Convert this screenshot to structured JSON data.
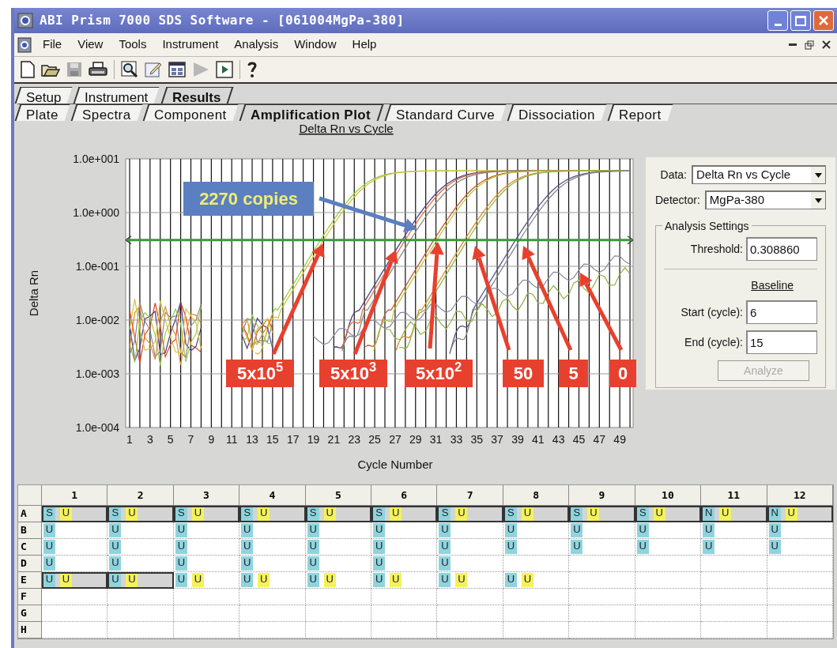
{
  "window": {
    "title": "ABI Prism 7000 SDS Software - [061004MgPa-380]"
  },
  "menu": [
    "File",
    "View",
    "Tools",
    "Instrument",
    "Analysis",
    "Window",
    "Help"
  ],
  "tabs": [
    {
      "label": "Setup",
      "selected": false
    },
    {
      "label": "Instrument",
      "selected": false
    },
    {
      "label": "Results",
      "selected": true
    }
  ],
  "subtabs": [
    {
      "label": "Plate",
      "selected": false
    },
    {
      "label": "Spectra",
      "selected": false
    },
    {
      "label": "Component",
      "selected": false
    },
    {
      "label": "Amplification Plot",
      "selected": true
    },
    {
      "label": "Standard Curve",
      "selected": false
    },
    {
      "label": "Dissociation",
      "selected": false
    },
    {
      "label": "Report",
      "selected": false
    }
  ],
  "plot": {
    "title": "Delta Rn vs Cycle",
    "ylabel": "Delta Rn",
    "xlabel": "Cycle Number",
    "yticks": [
      "1.0e+001",
      "1.0e+000",
      "1.0e-001",
      "1.0e-002",
      "1.0e-003",
      "1.0e-004"
    ],
    "xticks": [
      "1",
      "3",
      "5",
      "7",
      "9",
      "11",
      "13",
      "15",
      "17",
      "19",
      "21",
      "23",
      "25",
      "27",
      "29",
      "31",
      "33",
      "35",
      "37",
      "39",
      "41",
      "43",
      "45",
      "47",
      "49"
    ],
    "callouts": [
      {
        "text": "2270 copies",
        "color": "#5b7fc0"
      },
      {
        "text": "5x10$^{5}$",
        "color": "#e8402e"
      },
      {
        "text": "5x10$^{3}$",
        "color": "#e8402e"
      },
      {
        "text": "5x10$^{2}$",
        "color": "#e8402e"
      },
      {
        "text": "50",
        "color": "#e8402e"
      },
      {
        "text": "5",
        "color": "#e8402e"
      },
      {
        "text": "0",
        "color": "#e8402e"
      }
    ]
  },
  "panel": {
    "data": {
      "label": "Data:",
      "value": "Delta Rn vs Cycle"
    },
    "detector": {
      "label": "Detector:",
      "value": "MgPa-380"
    },
    "group": "Analysis Settings",
    "threshold": {
      "label": "Threshold:",
      "value": "0.308860"
    },
    "baseline": "Baseline",
    "start": {
      "label": "Start (cycle):",
      "value": "6"
    },
    "end": {
      "label": "End (cycle):",
      "value": "15"
    },
    "analyze": {
      "label": "Analyze",
      "disabled": true
    }
  },
  "plate": {
    "columns": [
      "1",
      "2",
      "3",
      "4",
      "5",
      "6",
      "7",
      "8",
      "9",
      "10",
      "11",
      "12"
    ],
    "rows": [
      {
        "label": "A",
        "wells": [
          {
            "selected": true,
            "tags": [
              {
                "text": "S",
                "color": "#8fd4dc"
              },
              {
                "text": "U",
                "color": "#f4f25c"
              }
            ]
          },
          {
            "selected": true,
            "tags": [
              {
                "text": "S",
                "color": "#8fd4dc"
              },
              {
                "text": "U",
                "color": "#f4f25c"
              }
            ]
          },
          {
            "selected": true,
            "tags": [
              {
                "text": "S",
                "color": "#8fd4dc"
              },
              {
                "text": "U",
                "color": "#f4f25c"
              }
            ]
          },
          {
            "selected": true,
            "tags": [
              {
                "text": "S",
                "color": "#8fd4dc"
              },
              {
                "text": "U",
                "color": "#f4f25c"
              }
            ]
          },
          {
            "selected": true,
            "tags": [
              {
                "text": "S",
                "color": "#8fd4dc"
              },
              {
                "text": "U",
                "color": "#f4f25c"
              }
            ]
          },
          {
            "selected": true,
            "tags": [
              {
                "text": "S",
                "color": "#8fd4dc"
              },
              {
                "text": "U",
                "color": "#f4f25c"
              }
            ]
          },
          {
            "selected": true,
            "tags": [
              {
                "text": "S",
                "color": "#8fd4dc"
              },
              {
                "text": "U",
                "color": "#f4f25c"
              }
            ]
          },
          {
            "selected": true,
            "tags": [
              {
                "text": "S",
                "color": "#8fd4dc"
              },
              {
                "text": "U",
                "color": "#f4f25c"
              }
            ]
          },
          {
            "selected": true,
            "tags": [
              {
                "text": "S",
                "color": "#8fd4dc"
              },
              {
                "text": "U",
                "color": "#f4f25c"
              }
            ]
          },
          {
            "selected": true,
            "tags": [
              {
                "text": "S",
                "color": "#8fd4dc"
              },
              {
                "text": "U",
                "color": "#f4f25c"
              }
            ]
          },
          {
            "selected": true,
            "tags": [
              {
                "text": "N",
                "color": "#8fd4dc"
              },
              {
                "text": "U",
                "color": "#f4f25c"
              }
            ]
          },
          {
            "selected": true,
            "tags": [
              {
                "text": "N",
                "color": "#8fd4dc"
              },
              {
                "text": "U",
                "color": "#f4f25c"
              }
            ]
          }
        ]
      },
      {
        "label": "B",
        "wells": [
          {
            "selected": false,
            "tags": [
              {
                "text": "U",
                "color": "#8fd4dc"
              }
            ]
          },
          {
            "selected": false,
            "tags": [
              {
                "text": "U",
                "color": "#8fd4dc"
              }
            ]
          },
          {
            "selected": false,
            "tags": [
              {
                "text": "U",
                "color": "#8fd4dc"
              }
            ]
          },
          {
            "selected": false,
            "tags": [
              {
                "text": "U",
                "color": "#8fd4dc"
              }
            ]
          },
          {
            "selected": false,
            "tags": [
              {
                "text": "U",
                "color": "#8fd4dc"
              }
            ]
          },
          {
            "selected": false,
            "tags": [
              {
                "text": "U",
                "color": "#8fd4dc"
              }
            ]
          },
          {
            "selected": false,
            "tags": [
              {
                "text": "U",
                "color": "#8fd4dc"
              }
            ]
          },
          {
            "selected": false,
            "tags": [
              {
                "text": "U",
                "color": "#8fd4dc"
              }
            ]
          },
          {
            "selected": false,
            "tags": [
              {
                "text": "U",
                "color": "#8fd4dc"
              }
            ]
          },
          {
            "selected": false,
            "tags": [
              {
                "text": "U",
                "color": "#8fd4dc"
              }
            ]
          },
          {
            "selected": false,
            "tags": [
              {
                "text": "U",
                "color": "#8fd4dc"
              }
            ]
          },
          {
            "selected": false,
            "tags": [
              {
                "text": "U",
                "color": "#8fd4dc"
              }
            ]
          }
        ]
      },
      {
        "label": "C",
        "wells": [
          {
            "selected": false,
            "tags": [
              {
                "text": "U",
                "color": "#8fd4dc"
              }
            ]
          },
          {
            "selected": false,
            "tags": [
              {
                "text": "U",
                "color": "#8fd4dc"
              }
            ]
          },
          {
            "selected": false,
            "tags": [
              {
                "text": "U",
                "color": "#8fd4dc"
              }
            ]
          },
          {
            "selected": false,
            "tags": [
              {
                "text": "U",
                "color": "#8fd4dc"
              }
            ]
          },
          {
            "selected": false,
            "tags": [
              {
                "text": "U",
                "color": "#8fd4dc"
              }
            ]
          },
          {
            "selected": false,
            "tags": [
              {
                "text": "U",
                "color": "#8fd4dc"
              }
            ]
          },
          {
            "selected": false,
            "tags": [
              {
                "text": "U",
                "color": "#8fd4dc"
              }
            ]
          },
          {
            "selected": false,
            "tags": [
              {
                "text": "U",
                "color": "#8fd4dc"
              }
            ]
          },
          {
            "selected": false,
            "tags": [
              {
                "text": "U",
                "color": "#8fd4dc"
              }
            ]
          },
          {
            "selected": false,
            "tags": [
              {
                "text": "U",
                "color": "#8fd4dc"
              }
            ]
          },
          {
            "selected": false,
            "tags": [
              {
                "text": "U",
                "color": "#8fd4dc"
              }
            ]
          },
          {
            "selected": false,
            "tags": [
              {
                "text": "U",
                "color": "#8fd4dc"
              }
            ]
          }
        ]
      },
      {
        "label": "D",
        "wells": [
          {
            "selected": false,
            "tags": [
              {
                "text": "U",
                "color": "#8fd4dc"
              }
            ]
          },
          {
            "selected": false,
            "tags": [
              {
                "text": "U",
                "color": "#8fd4dc"
              }
            ]
          },
          {
            "selected": false,
            "tags": [
              {
                "text": "U",
                "color": "#8fd4dc"
              }
            ]
          },
          {
            "selected": false,
            "tags": [
              {
                "text": "U",
                "color": "#8fd4dc"
              }
            ]
          },
          {
            "selected": false,
            "tags": [
              {
                "text": "U",
                "color": "#8fd4dc"
              }
            ]
          },
          {
            "selected": false,
            "tags": [
              {
                "text": "U",
                "color": "#8fd4dc"
              }
            ]
          },
          {
            "selected": false,
            "tags": [
              {
                "text": "U",
                "color": "#8fd4dc"
              }
            ]
          },
          {
            "selected": false
          },
          {
            "selected": false
          },
          {
            "selected": false
          },
          {
            "selected": false
          },
          {
            "selected": false
          }
        ]
      },
      {
        "label": "E",
        "wells": [
          {
            "selected": true,
            "tags": [
              {
                "text": "U",
                "color": "#8fd4dc"
              },
              {
                "text": "U",
                "color": "#f4f25c"
              }
            ]
          },
          {
            "selected": true,
            "tags": [
              {
                "text": "U",
                "color": "#8fd4dc"
              },
              {
                "text": "U",
                "color": "#f4f25c"
              }
            ]
          },
          {
            "selected": false,
            "tags": [
              {
                "text": "U",
                "color": "#8fd4dc"
              },
              {
                "text": "U",
                "color": "#f4f25c"
              }
            ]
          },
          {
            "selected": false,
            "tags": [
              {
                "text": "U",
                "color": "#8fd4dc"
              },
              {
                "text": "U",
                "color": "#f4f25c"
              }
            ]
          },
          {
            "selected": false,
            "tags": [
              {
                "text": "U",
                "color": "#8fd4dc"
              },
              {
                "text": "U",
                "color": "#f4f25c"
              }
            ]
          },
          {
            "selected": false,
            "tags": [
              {
                "text": "U",
                "color": "#8fd4dc"
              },
              {
                "text": "U",
                "color": "#f4f25c"
              }
            ]
          },
          {
            "selected": false,
            "tags": [
              {
                "text": "U",
                "color": "#8fd4dc"
              },
              {
                "text": "U",
                "color": "#f4f25c"
              }
            ]
          },
          {
            "selected": false,
            "tags": [
              {
                "text": "U",
                "color": "#8fd4dc"
              },
              {
                "text": "U",
                "color": "#f4f25c"
              }
            ]
          },
          {
            "selected": false
          },
          {
            "selected": false
          },
          {
            "selected": false
          },
          {
            "selected": false
          }
        ]
      },
      {
        "label": "F",
        "wells": [
          {
            "selected": false
          },
          {
            "selected": false
          },
          {
            "selected": false
          },
          {
            "selected": false
          },
          {
            "selected": false
          },
          {
            "selected": false
          },
          {
            "selected": false
          },
          {
            "selected": false
          },
          {
            "selected": false
          },
          {
            "selected": false
          },
          {
            "selected": false
          },
          {
            "selected": false
          }
        ]
      },
      {
        "label": "G",
        "wells": [
          {
            "selected": false
          },
          {
            "selected": false
          },
          {
            "selected": false
          },
          {
            "selected": false
          },
          {
            "selected": false
          },
          {
            "selected": false
          },
          {
            "selected": false
          },
          {
            "selected": false
          },
          {
            "selected": false
          },
          {
            "selected": false
          },
          {
            "selected": false
          },
          {
            "selected": false
          }
        ]
      },
      {
        "label": "H",
        "wells": [
          {
            "selected": false
          },
          {
            "selected": false
          },
          {
            "selected": false
          },
          {
            "selected": false
          },
          {
            "selected": false
          },
          {
            "selected": false
          },
          {
            "selected": false
          },
          {
            "selected": false
          },
          {
            "selected": false
          },
          {
            "selected": false
          },
          {
            "selected": false
          },
          {
            "selected": false
          }
        ]
      }
    ]
  }
}
